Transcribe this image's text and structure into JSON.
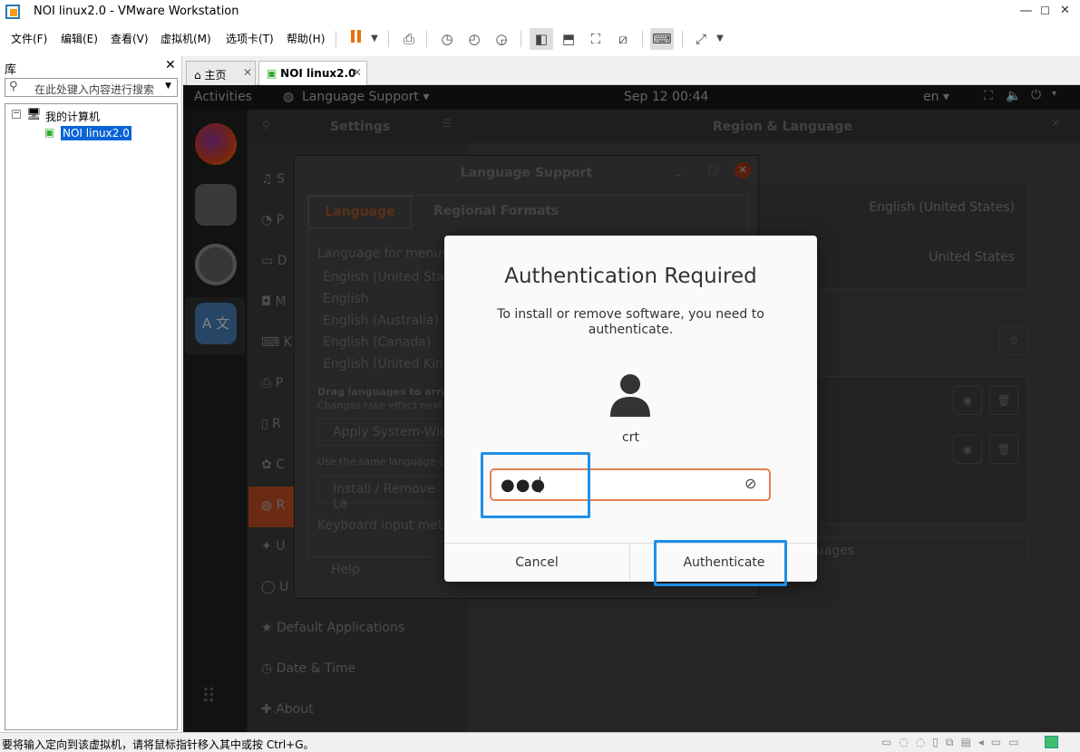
{
  "window": {
    "title": "NOI linux2.0 - VMware Workstation",
    "min": "—",
    "max": "☐",
    "close": "✕"
  },
  "menu": [
    "文件(F)",
    "编辑(E)",
    "查看(V)",
    "虚拟机(M)",
    "选项卡(T)",
    "帮助(H)"
  ],
  "library": {
    "title": "库",
    "search_placeholder": "在此处键入内容进行搜索",
    "tree_root": "我的计算机",
    "tree_vm": "NOI linux2.0"
  },
  "tabs": [
    {
      "label": "主页"
    },
    {
      "label": "NOI linux2.0"
    }
  ],
  "status_text": "要将输入定向到该虚拟机，请将鼠标指针移入其中或按 Ctrl+G。",
  "ubuntu": {
    "activities": "Activities",
    "app_menu": "Language Support ▾",
    "clock": "Sep 12  00:44",
    "lang": "en ▾",
    "settings_title": "Settings",
    "panel_title": "Region & Language",
    "sidebar_visible": [
      "Default Applications",
      "Date & Time",
      "About"
    ],
    "sidebar_partial": [
      "S",
      "P",
      "D",
      "M",
      "K",
      "P",
      "R",
      "C",
      "R",
      "U",
      "U"
    ],
    "region_language_value": "English (United States)",
    "region_formats_value": "United States",
    "manage_languages_partial": "guages",
    "language_support": {
      "title": "Language Support",
      "tab_language": "Language",
      "tab_regional": "Regional Formats",
      "list_label": "Language for menus a",
      "languages": [
        "English (United State",
        "English",
        "English (Australia)",
        "English (Canada)",
        "English (United Kingd"
      ],
      "drag_hint": "Drag languages to arran",
      "changes_hint": "Changes take effect next",
      "apply_btn": "Apply System-Wid",
      "same_lang_hint": "Use the same language ch",
      "install_btn": "Install / Remove La",
      "keyboard_label": "Keyboard input meth",
      "help_btn": "Help"
    }
  },
  "auth": {
    "title": "Authentication Required",
    "message": "To install or remove software, you need to authenticate.",
    "username": "crt",
    "password_mask": "●●●",
    "cancel": "Cancel",
    "authenticate": "Authenticate"
  }
}
